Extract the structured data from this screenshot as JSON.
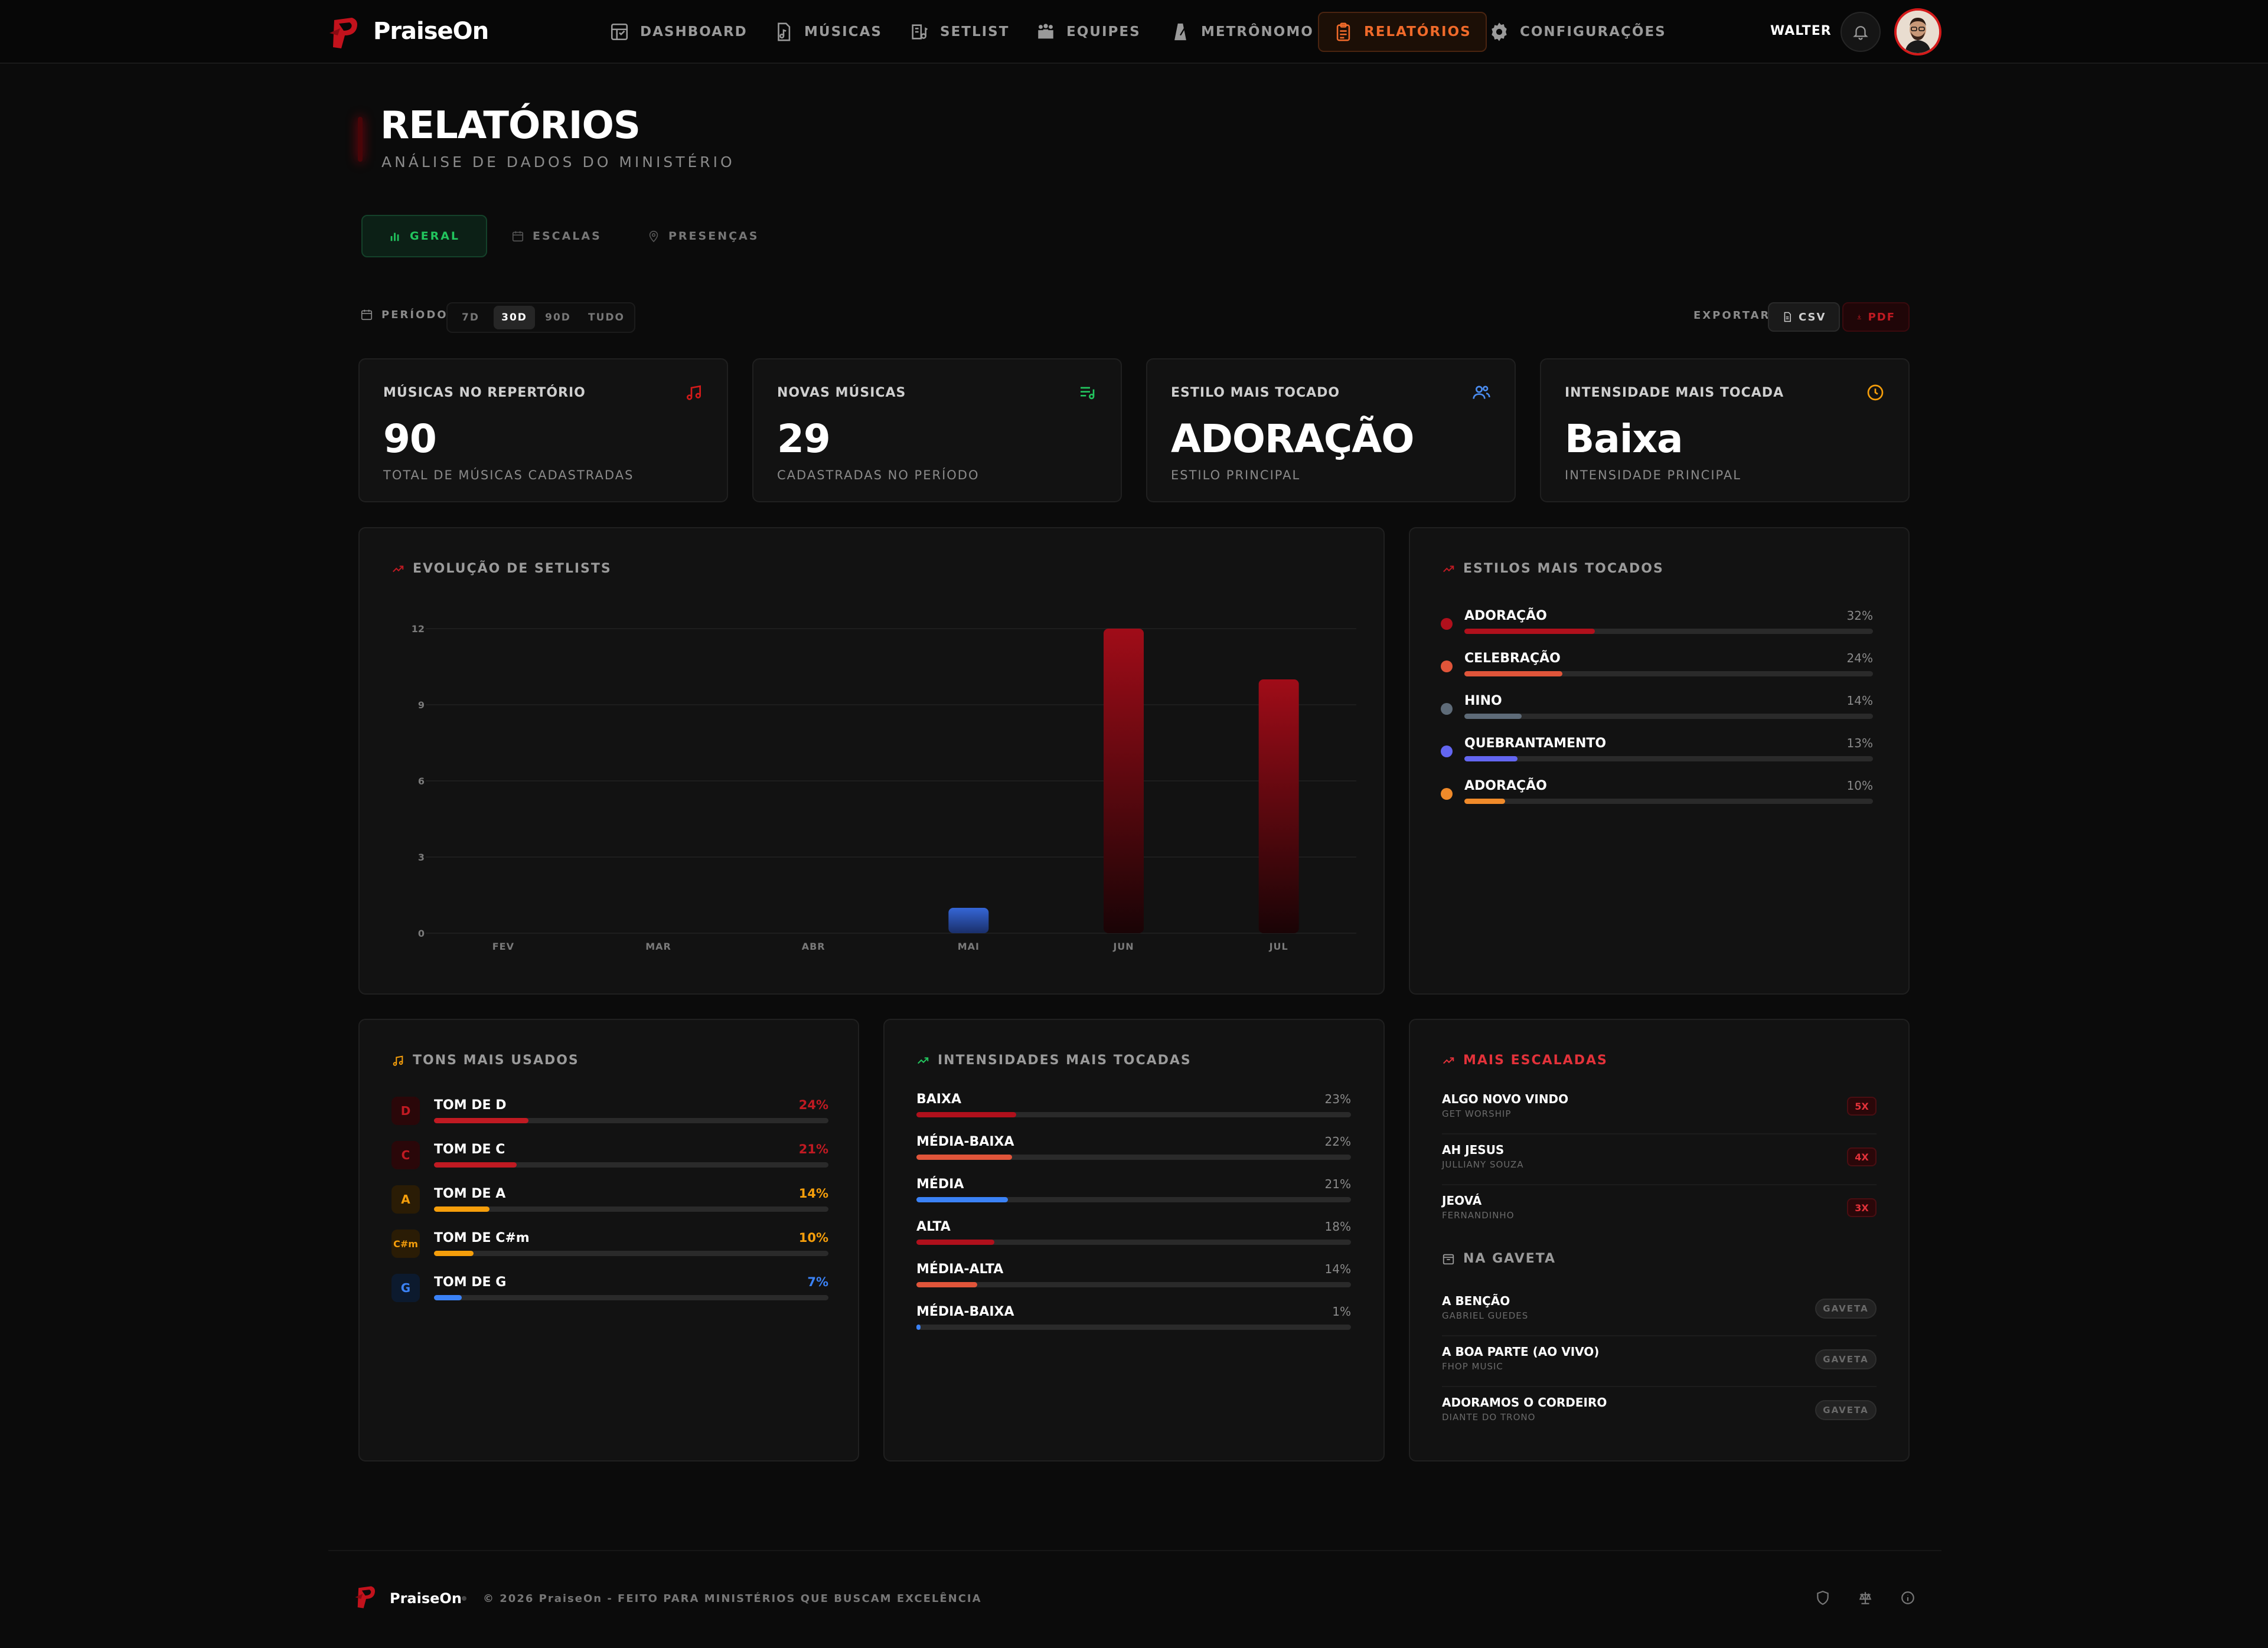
{
  "brand": {
    "name": "PraiseOn"
  },
  "nav": {
    "items": [
      {
        "label": "DASHBOARD",
        "icon": "dashboard-icon"
      },
      {
        "label": "MÚSICAS",
        "icon": "music-file-icon"
      },
      {
        "label": "SETLIST",
        "icon": "setlist-icon"
      },
      {
        "label": "EQUIPES",
        "icon": "team-icon"
      },
      {
        "label": "METRÔNOMO",
        "icon": "metronome-icon"
      },
      {
        "label": "RELATÓRIOS",
        "icon": "report-icon",
        "active": true
      },
      {
        "label": "CONFIGURAÇÕES",
        "icon": "gear-icon"
      }
    ],
    "user": "WALTER"
  },
  "header": {
    "title": "RELATÓRIOS",
    "subtitle": "ANÁLISE DE DADOS DO MINISTÉRIO"
  },
  "tabs": [
    {
      "label": "GERAL",
      "active": true
    },
    {
      "label": "ESCALAS"
    },
    {
      "label": "PRESENÇAS"
    }
  ],
  "period": {
    "label": "PERÍODO:",
    "options": [
      "7D",
      "30D",
      "90D",
      "TUDO"
    ],
    "selected": "30D"
  },
  "export": {
    "label": "EXPORTAR:",
    "csv": "CSV",
    "pdf": "PDF"
  },
  "stats": [
    {
      "label": "MÚSICAS NO REPERTÓRIO",
      "value": "90",
      "sub": "TOTAL DE MÚSICAS CADASTRADAS",
      "icon": "music-note-icon",
      "color": "#d41a1a"
    },
    {
      "label": "NOVAS MÚSICAS",
      "value": "29",
      "sub": "CADASTRADAS NO PERÍODO",
      "icon": "playlist-add-icon",
      "color": "#22c55e"
    },
    {
      "label": "ESTILO MAIS TOCADO",
      "value": "ADORAÇÃO",
      "sub": "ESTILO PRINCIPAL",
      "icon": "users-icon",
      "color": "#4a8cf0"
    },
    {
      "label": "INTENSIDADE MAIS TOCADA",
      "value": "Baixa",
      "sub": "INTENSIDADE PRINCIPAL",
      "icon": "clock-icon",
      "color": "#f59e0b"
    }
  ],
  "setlist_chart": {
    "title": "EVOLUÇÃO DE SETLISTS"
  },
  "chart_data": {
    "type": "bar",
    "title": "EVOLUÇÃO DE SETLISTS",
    "categories": [
      "FEV",
      "MAR",
      "ABR",
      "MAI",
      "JUN",
      "JUL"
    ],
    "values": [
      0,
      0,
      0,
      1,
      12,
      10
    ],
    "ylim": [
      0,
      12
    ],
    "yticks": [
      0,
      3,
      6,
      9,
      12
    ],
    "grid": true,
    "colors": [
      "#a00c18",
      "#a00c18",
      "#a00c18",
      "#2f5fcf",
      "#a00c18",
      "#a00c18"
    ]
  },
  "styles": {
    "title": "ESTILOS MAIS TOCADOS",
    "items": [
      {
        "name": "ADORAÇÃO",
        "pct": 32,
        "label": "32%",
        "color": "#b0101c"
      },
      {
        "name": "CELEBRAÇÃO",
        "pct": 24,
        "label": "24%",
        "color": "#e0553a"
      },
      {
        "name": "HINO",
        "pct": 14,
        "label": "14%",
        "color": "#5e6b78"
      },
      {
        "name": "QUEBRANTAMENTO",
        "pct": 13,
        "label": "13%",
        "color": "#6366f1"
      },
      {
        "name": "ADORAÇÃO",
        "pct": 10,
        "label": "10%",
        "color": "#f08a2a"
      }
    ]
  },
  "keys": {
    "title": "TONS MAIS USADOS",
    "items": [
      {
        "badge": "D",
        "name": "TOM DE D",
        "pct": 24,
        "label": "24%",
        "color": "#c01a22",
        "bg": "#2a0709"
      },
      {
        "badge": "C",
        "name": "TOM DE C",
        "pct": 21,
        "label": "21%",
        "color": "#c01a22",
        "bg": "#2a0709"
      },
      {
        "badge": "A",
        "name": "TOM DE A",
        "pct": 14,
        "label": "14%",
        "color": "#f59e0b",
        "bg": "#2a1c05"
      },
      {
        "badge": "C#m",
        "name": "TOM DE C#m",
        "pct": 10,
        "label": "10%",
        "color": "#f59e0b",
        "bg": "#2a1c05"
      },
      {
        "badge": "G",
        "name": "TOM DE G",
        "pct": 7,
        "label": "7%",
        "color": "#3b82f6",
        "bg": "#0c1a2e"
      }
    ]
  },
  "intensities": {
    "title": "INTENSIDADES MAIS TOCADAS",
    "items": [
      {
        "name": "BAIXA",
        "pct": 23,
        "label": "23%",
        "color": "#b0101c"
      },
      {
        "name": "MÉDIA-BAIXA",
        "pct": 22,
        "label": "22%",
        "color": "#e0553a"
      },
      {
        "name": "MÉDIA",
        "pct": 21,
        "label": "21%",
        "color": "#3b82f6"
      },
      {
        "name": "ALTA",
        "pct": 18,
        "label": "18%",
        "color": "#b0101c"
      },
      {
        "name": "MÉDIA-ALTA",
        "pct": 14,
        "label": "14%",
        "color": "#e0553a"
      },
      {
        "name": "MÉDIA-BAIXA",
        "pct": 1,
        "label": "1%",
        "color": "#3b82f6"
      }
    ]
  },
  "scaled": {
    "title": "MAIS ESCALADAS",
    "items": [
      {
        "title": "ALGO NOVO VINDO",
        "artist": "GET WORSHIP",
        "count": "5X"
      },
      {
        "title": "AH JESUS",
        "artist": "JULLIANY SOUZA",
        "count": "4X"
      },
      {
        "title": "JEOVÁ",
        "artist": "FERNANDINHO",
        "count": "3X"
      }
    ]
  },
  "drawer": {
    "title": "NA GAVETA",
    "items": [
      {
        "title": "A BENÇÃO",
        "artist": "GABRIEL GUEDES",
        "badge": "GAVETA"
      },
      {
        "title": "A BOA PARTE (AO VIVO)",
        "artist": "FHOP MUSIC",
        "badge": "GAVETA"
      },
      {
        "title": "ADORAMOS O CORDEIRO",
        "artist": "DIANTE DO TRONO",
        "badge": "GAVETA"
      }
    ]
  },
  "footer": {
    "brand": "PraiseOn",
    "copyright": "© 2026 PraiseOn - FEITO PARA MINISTÉRIOS QUE BUSCAM EXCELÊNCIA",
    "icons": [
      "shield-icon",
      "scale-icon",
      "info-icon"
    ]
  }
}
